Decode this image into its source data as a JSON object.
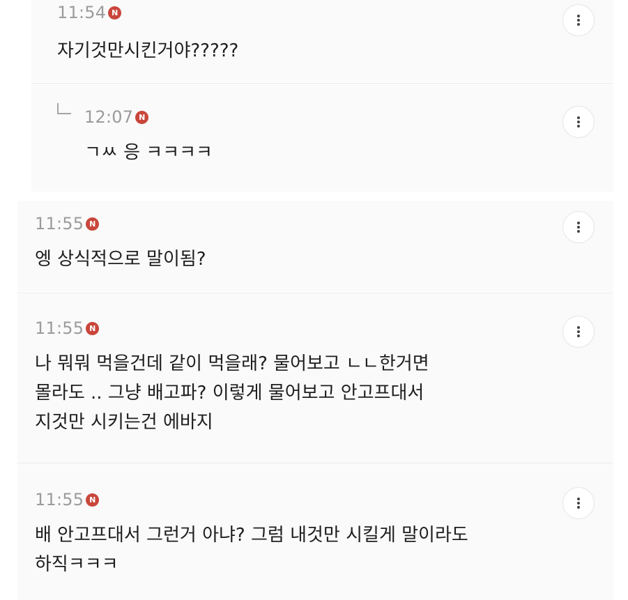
{
  "comments": [
    {
      "time": "11:54",
      "badge": "N",
      "text": "자기것만시킨거야?????",
      "more_icon": "more-vertical-icon",
      "is_reply": false
    },
    {
      "time": "12:07",
      "badge": "N",
      "text": "ㄱㅆ 응 ㅋㅋㅋㅋ",
      "more_icon": "more-vertical-icon",
      "is_reply": true,
      "reply_icon": "reply-arrow-icon"
    },
    {
      "time": "11:55",
      "badge": "N",
      "text": "엥 상식적으로 말이됨?",
      "more_icon": "more-vertical-icon",
      "is_reply": false
    },
    {
      "time": "11:55",
      "badge": "N",
      "text": "나 뭐뭐 먹을건데 같이 먹을래? 물어보고 ㄴㄴ한거면\n몰라도 .. 그냥 배고파? 이렇게 물어보고 안고프대서\n지것만 시키는건 에바지",
      "more_icon": "more-vertical-icon",
      "is_reply": false
    },
    {
      "time": "11:55",
      "badge": "N",
      "text": "배 안고프대서 그런거 아냐? 그럼 내것만 시킬게 말이라도\n하직ㅋㅋㅋ",
      "more_icon": "more-vertical-icon",
      "is_reply": false
    }
  ],
  "colors": {
    "badge": "#c9463b",
    "time": "#9b9b9b",
    "text": "#1d1d1d",
    "background": "#fafafa"
  }
}
